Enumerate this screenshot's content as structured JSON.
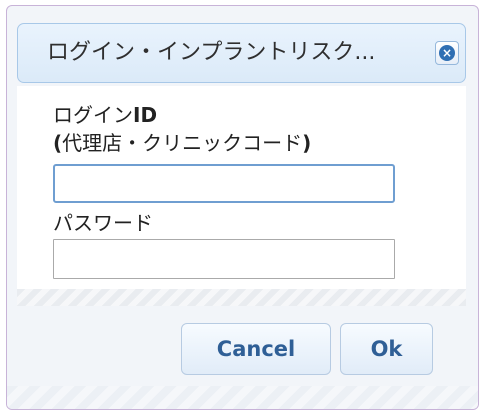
{
  "dialog": {
    "title": "ログイン・インプラントリスク...",
    "close_icon": "close-icon",
    "login_id_label_prefix": "ログイン",
    "login_id_label_bold": "ID",
    "login_id_sublabel_open": "(",
    "login_id_sublabel_text": "代理店・クリニックコード",
    "login_id_sublabel_close": ")",
    "login_id_value": "",
    "password_label": "パスワード",
    "password_value": "",
    "cancel_label": "Cancel",
    "ok_label": "Ok"
  },
  "colors": {
    "title_bg": "#e3eefa",
    "button_text": "#2f5f96",
    "input_focus_border": "#6f9ed1"
  }
}
